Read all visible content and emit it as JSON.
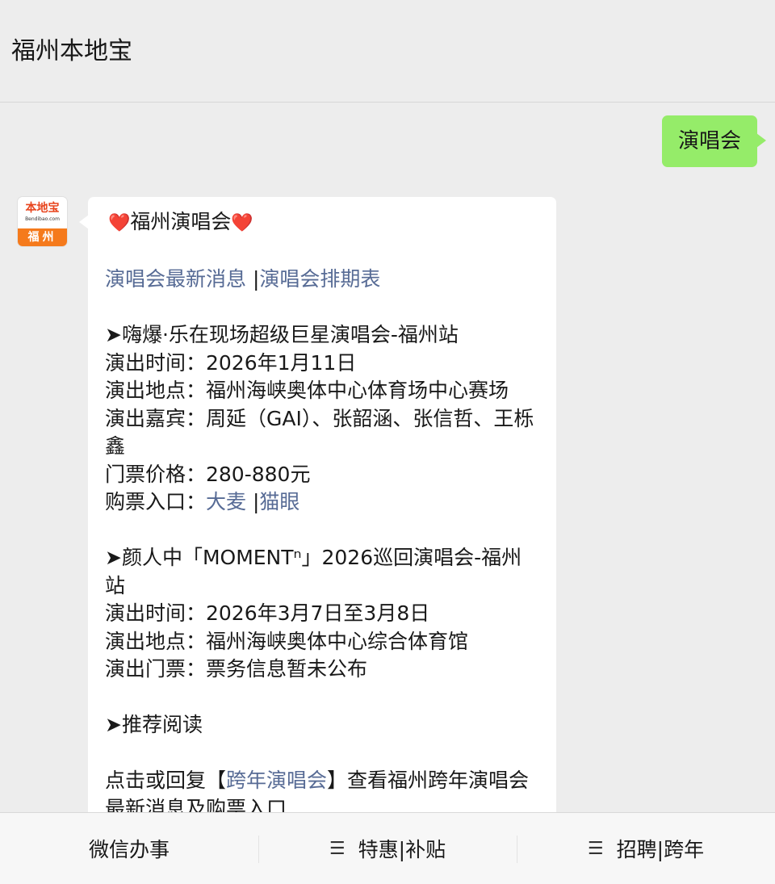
{
  "header": {
    "title": "福州本地宝"
  },
  "chat": {
    "user_message": "演唱会",
    "avatar": {
      "top_text": "本地宝",
      "url_text": "Bendibao.com",
      "bottom_text": "福州"
    },
    "reply": {
      "heart_icon": "❤️",
      "title": "福州演唱会",
      "links_row": {
        "link1": "演唱会最新消息",
        "separator": "|",
        "link2": "演唱会排期表"
      },
      "concert1": {
        "name": "➤嗨爆·乐在现场超级巨星演唱会-福州站",
        "time": "演出时间：2026年1月11日",
        "venue": "演出地点：福州海峡奥体中心体育场中心赛场",
        "guests": "演出嘉宾：周延（GAI）、张韶涵、张信哲、王栎鑫",
        "price": "门票价格：280-880元",
        "ticket_label": "购票入口：",
        "ticket_link1": "大麦",
        "ticket_sep": "|",
        "ticket_link2": "猫眼"
      },
      "concert2": {
        "name": "➤颜人中「MOMENTⁿ」2026巡回演唱会-福州站",
        "time": "演出时间：2026年3月7日至3月8日",
        "venue": "演出地点：福州海峡奥体中心综合体育馆",
        "tickets": "演出门票：票务信息暂未公布"
      },
      "recommend": "➤推荐阅读",
      "reply_hint": {
        "prefix": "点击或回复【",
        "link": "跨年演唱会",
        "suffix": "】查看福州跨年演唱会最新消息及购票入口"
      }
    }
  },
  "menu": {
    "items": [
      {
        "label": "微信办事",
        "icon": ""
      },
      {
        "label": "特惠|补贴",
        "icon": "☰"
      },
      {
        "label": "招聘|跨年",
        "icon": "☰"
      }
    ]
  },
  "colors": {
    "background": "#ededed",
    "user_bubble": "#95ec69",
    "reply_bubble": "#ffffff",
    "link": "#576b95",
    "menu_bg": "#f7f7f7"
  }
}
